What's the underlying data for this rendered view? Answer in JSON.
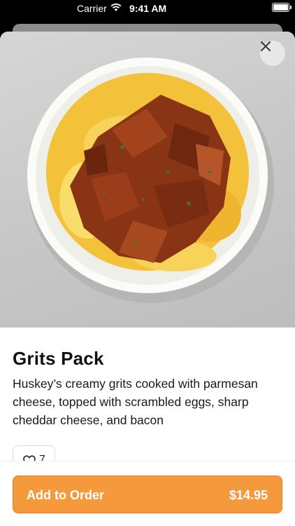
{
  "status_bar": {
    "carrier": "Carrier",
    "time": "9:41 AM"
  },
  "item": {
    "name": "Grits Pack",
    "description": "Huskey’s creamy grits cooked with parmesan cheese, topped with scrambled eggs, sharp cheddar cheese, and bacon",
    "likes": "7",
    "image_icon": "food-photo"
  },
  "actions": {
    "close_icon": "close-icon",
    "add_label": "Add to Order",
    "price": "$14.95"
  },
  "colors": {
    "accent": "#f49a3c",
    "accent_border": "#e0802b",
    "text": "#111111"
  }
}
